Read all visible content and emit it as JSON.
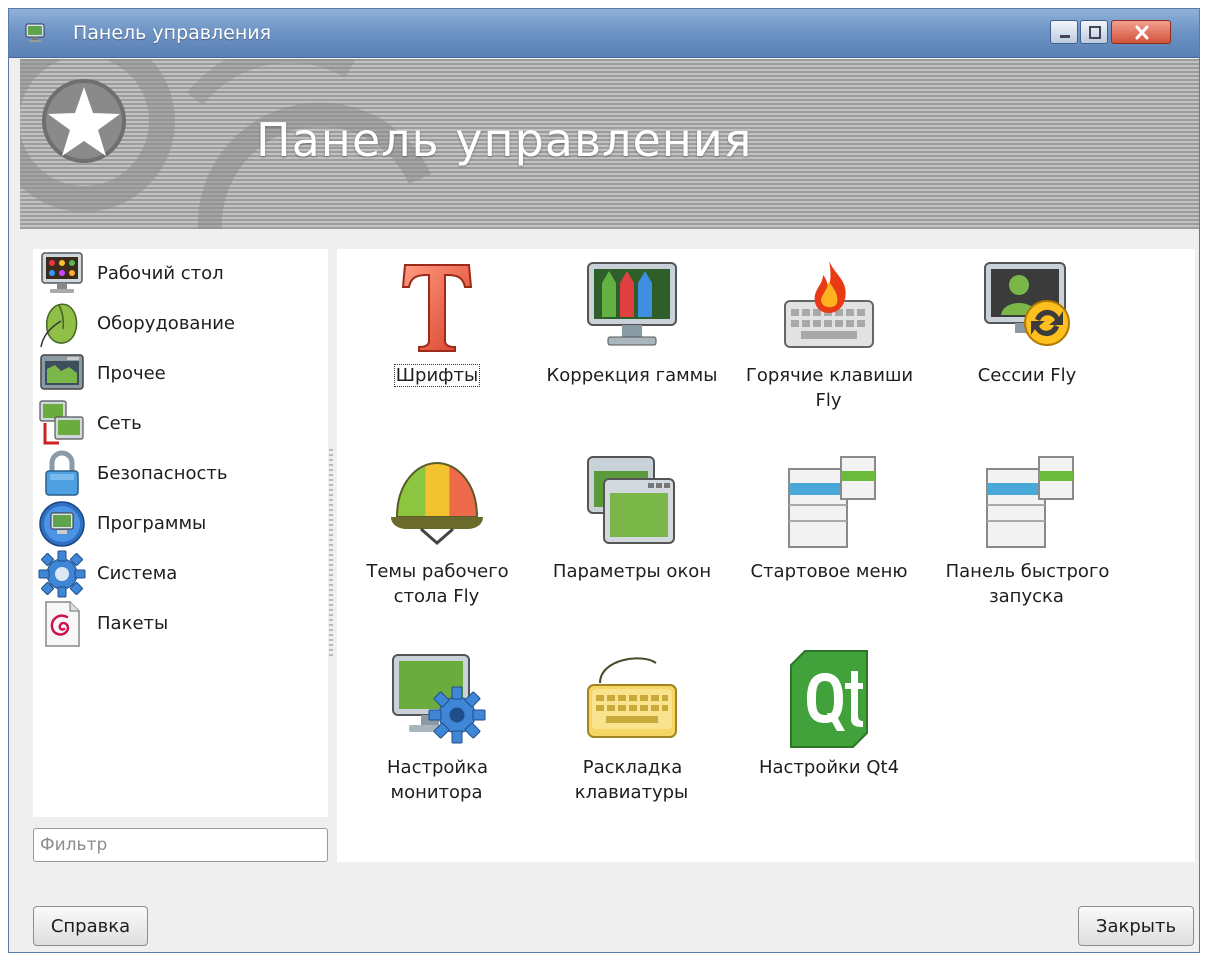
{
  "window": {
    "title": "Панель управления",
    "banner_title": "Панель управления"
  },
  "sidebar": {
    "items": [
      {
        "label": "Рабочий стол",
        "icon": "desktop-palette-icon"
      },
      {
        "label": "Оборудование",
        "icon": "mouse-icon"
      },
      {
        "label": "Прочее",
        "icon": "map-screen-icon"
      },
      {
        "label": "Сеть",
        "icon": "network-computers-icon"
      },
      {
        "label": "Безопасность",
        "icon": "padlock-icon"
      },
      {
        "label": "Программы",
        "icon": "programs-monitor-icon"
      },
      {
        "label": "Система",
        "icon": "gear-icon"
      },
      {
        "label": "Пакеты",
        "icon": "debian-package-icon"
      }
    ]
  },
  "filter": {
    "placeholder": "Фильтр",
    "value": ""
  },
  "applets": [
    {
      "label": "Шрифты",
      "icon": "font-t-icon",
      "focused": true
    },
    {
      "label": "Коррекция гаммы",
      "icon": "gamma-pencils-monitor-icon"
    },
    {
      "label": "Горячие клавиши Fly",
      "icon": "hotkeys-keyboard-flame-icon"
    },
    {
      "label": "Сессии Fly",
      "icon": "sessions-user-refresh-icon"
    },
    {
      "label": "Темы рабочего стола Fly",
      "icon": "themes-helmet-icon"
    },
    {
      "label": "Параметры окон",
      "icon": "windows-stack-icon"
    },
    {
      "label": "Стартовое меню",
      "icon": "start-menu-icon"
    },
    {
      "label": "Панель быстрого запуска",
      "icon": "quick-launch-panel-icon"
    },
    {
      "label": "Настройка монитора",
      "icon": "monitor-gear-icon"
    },
    {
      "label": "Раскладка клавиатуры",
      "icon": "keyboard-layout-icon"
    },
    {
      "label": "Настройки Qt4",
      "icon": "qt-logo-icon"
    }
  ],
  "buttons": {
    "help": "Справка",
    "close": "Закрыть"
  },
  "colors": {
    "titlebar": "#6f95c6",
    "banner": "#b0b0b0",
    "panel_bg": "#efefef"
  }
}
